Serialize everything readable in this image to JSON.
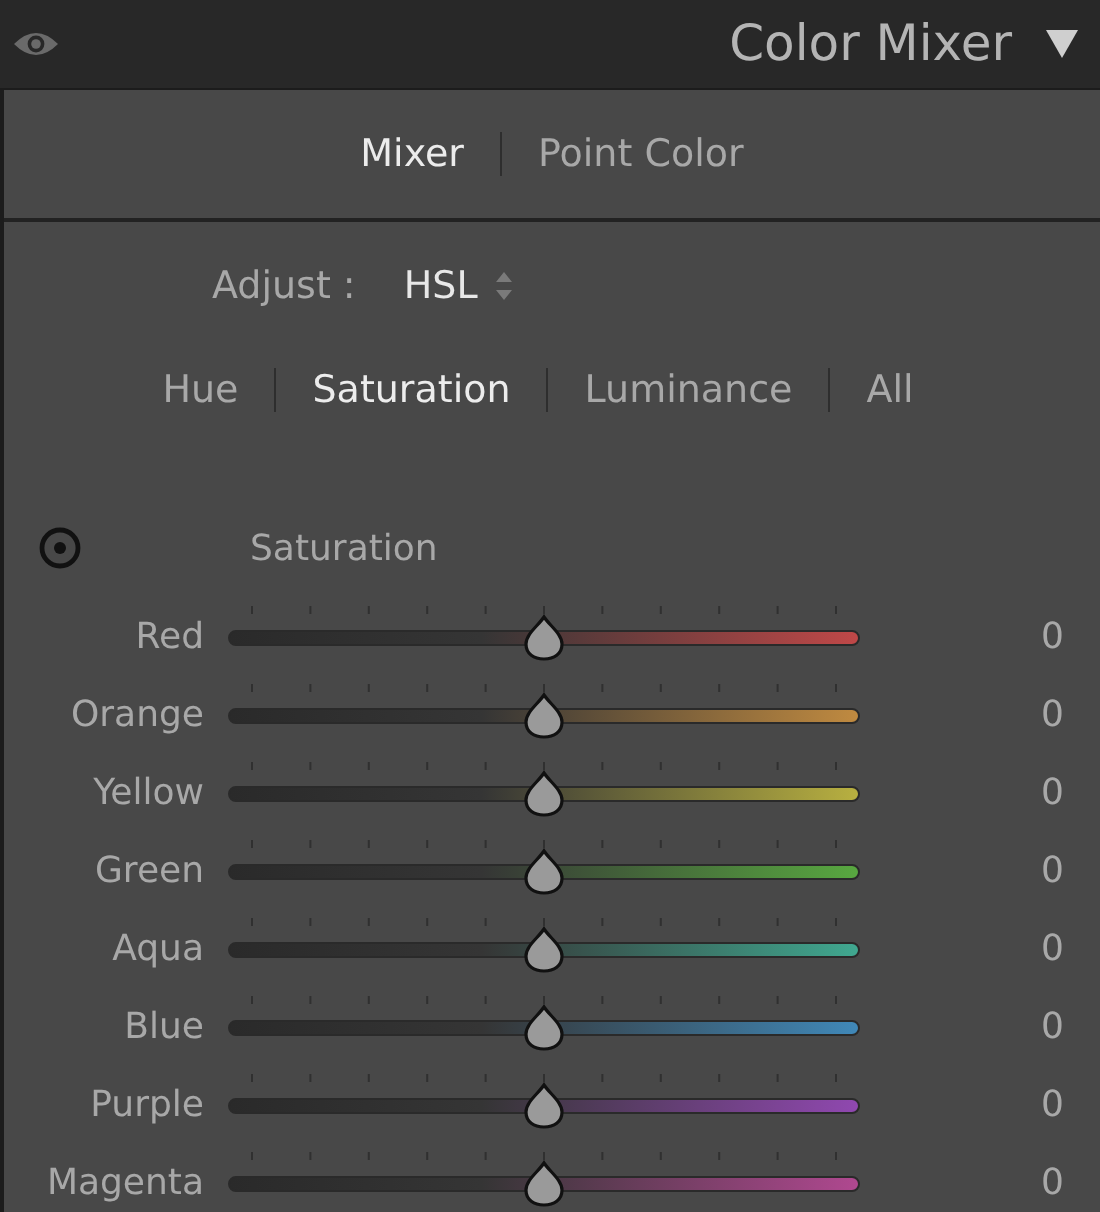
{
  "header": {
    "title": "Color Mixer",
    "expanded": true
  },
  "mode_tabs": [
    {
      "label": "Mixer",
      "selected": true
    },
    {
      "label": "Point Color",
      "selected": false
    }
  ],
  "adjust": {
    "label": "Adjust :",
    "value": "HSL"
  },
  "property_tabs": [
    {
      "label": "Hue",
      "selected": false
    },
    {
      "label": "Saturation",
      "selected": true
    },
    {
      "label": "Luminance",
      "selected": false
    },
    {
      "label": "All",
      "selected": false
    }
  ],
  "section_title": "Saturation",
  "sliders": [
    {
      "name": "Red",
      "color": "#c04848",
      "level": 0.5,
      "reading": "0"
    },
    {
      "name": "Orange",
      "color": "#c08a40",
      "level": 0.5,
      "reading": "0"
    },
    {
      "name": "Yellow",
      "color": "#b8b040",
      "level": 0.5,
      "reading": "0"
    },
    {
      "name": "Green",
      "color": "#58a840",
      "level": 0.5,
      "reading": "0"
    },
    {
      "name": "Aqua",
      "color": "#40a890",
      "level": 0.5,
      "reading": "0"
    },
    {
      "name": "Blue",
      "color": "#4088b8",
      "level": 0.5,
      "reading": "0"
    },
    {
      "name": "Purple",
      "color": "#9048b0",
      "level": 0.5,
      "reading": "0"
    },
    {
      "name": "Magenta",
      "color": "#b04890",
      "level": 0.5,
      "reading": "0"
    }
  ]
}
